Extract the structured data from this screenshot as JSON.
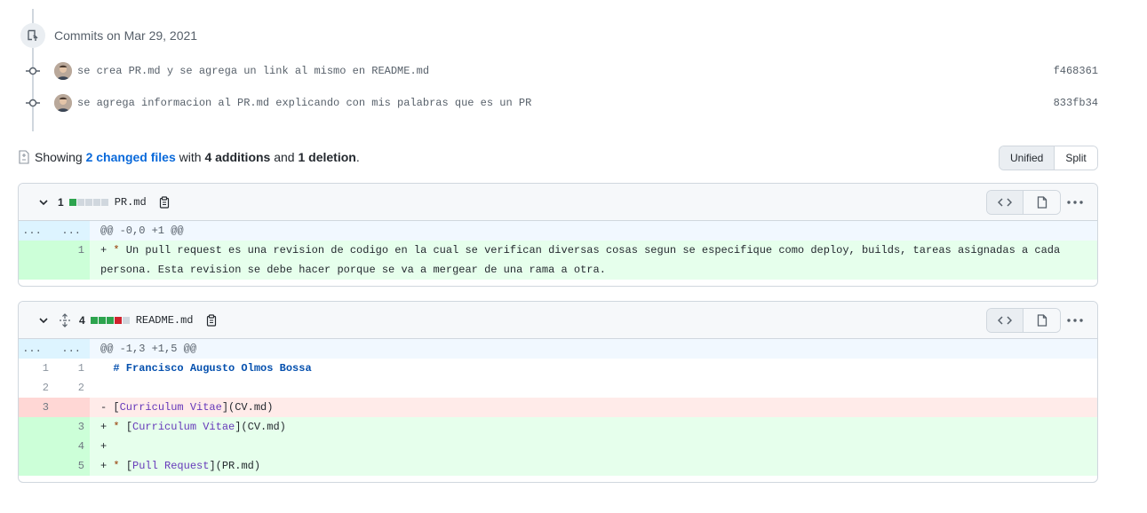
{
  "commits": {
    "title": "Commits on Mar 29, 2021",
    "items": [
      {
        "message": "se crea PR.md y se agrega un link al mismo en README.md",
        "sha": "f468361"
      },
      {
        "message": "se agrega informacion al PR.md explicando con mis palabras que es un PR",
        "sha": "833fb34"
      }
    ]
  },
  "summary": {
    "prefix": "Showing",
    "changed_files": "2 changed files",
    "with": "with",
    "additions": "4 additions",
    "and": "and",
    "deletions": "1 deletion",
    "period": "."
  },
  "view_toggle": {
    "unified": "Unified",
    "split": "Split"
  },
  "files": [
    {
      "count": "1",
      "name": "PR.md",
      "hunk": "@@ -0,0 +1 @@",
      "ellipsis_left": "...",
      "ellipsis_right": "...",
      "lines": [
        {
          "new": "1",
          "sign": "+",
          "star": "*",
          "text": " Un pull request es una revision de codigo en la cual se verifican diversas cosas segun se especifique como deploy, builds, tareas asignadas a cada persona. Esta revision se debe hacer porque se va a mergear de una rama a otra."
        }
      ]
    },
    {
      "count": "4",
      "name": "README.md",
      "hunk": "@@ -1,3 +1,5 @@",
      "ellipsis_left": "...",
      "ellipsis_right": "...",
      "lines": [
        {
          "old": "1",
          "new": "1",
          "text": "# Francisco Augusto Olmos Bossa"
        },
        {
          "old": "2",
          "new": "2",
          "text": ""
        },
        {
          "old": "3",
          "sign": "-",
          "pre": "[",
          "link": "Curriculum Vitae",
          "post": "](CV.md)"
        },
        {
          "new": "3",
          "sign": "+",
          "star": "*",
          "pre": "[",
          "link": "Curriculum Vitae",
          "post": "](CV.md)"
        },
        {
          "new": "4",
          "sign": "+"
        },
        {
          "new": "5",
          "sign": "+",
          "star": "*",
          "pre": "[",
          "link": "Pull Request",
          "post": "](PR.md)"
        }
      ]
    }
  ],
  "colors": {
    "addition": "#2da44e",
    "deletion": "#cf222e",
    "neutral": "#d0d7de",
    "link": "#0969da"
  }
}
